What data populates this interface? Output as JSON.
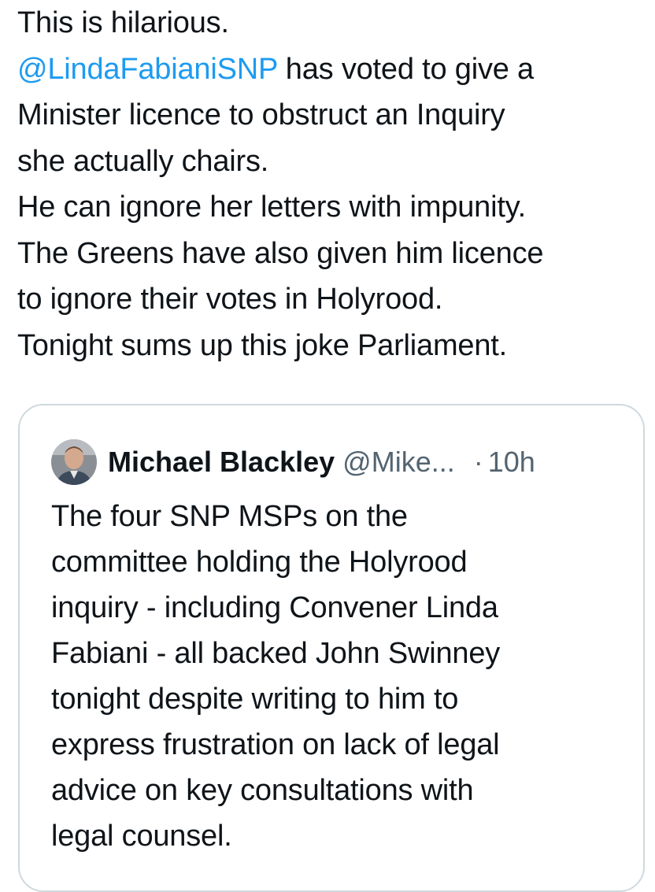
{
  "tweet": {
    "lines": [
      "This is hilarious.",
      "has voted to give a",
      "Minister licence to obstruct an Inquiry",
      "she actually chairs.",
      "He can ignore her letters with impunity.",
      "The Greens have also given him licence",
      "to ignore their votes in Holyrood.",
      "Tonight sums up this joke Parliament."
    ],
    "mention": "@LindaFabianiSNP"
  },
  "quote": {
    "author_name": "Michael Blackley",
    "author_handle": "@Mike...",
    "separator": "·",
    "time": "10h",
    "lines": [
      "The four SNP MSPs on the",
      "committee holding the Holyrood",
      "inquiry - including Convener Linda",
      "Fabiani - all backed John Swinney",
      "tonight despite writing to him to",
      "express frustration on lack of legal",
      "advice on key consultations with",
      "legal counsel."
    ]
  },
  "colors": {
    "mention": "#1d9bf0",
    "text": "#0f1419",
    "secondary": "#536471",
    "border": "#cfd9de"
  }
}
